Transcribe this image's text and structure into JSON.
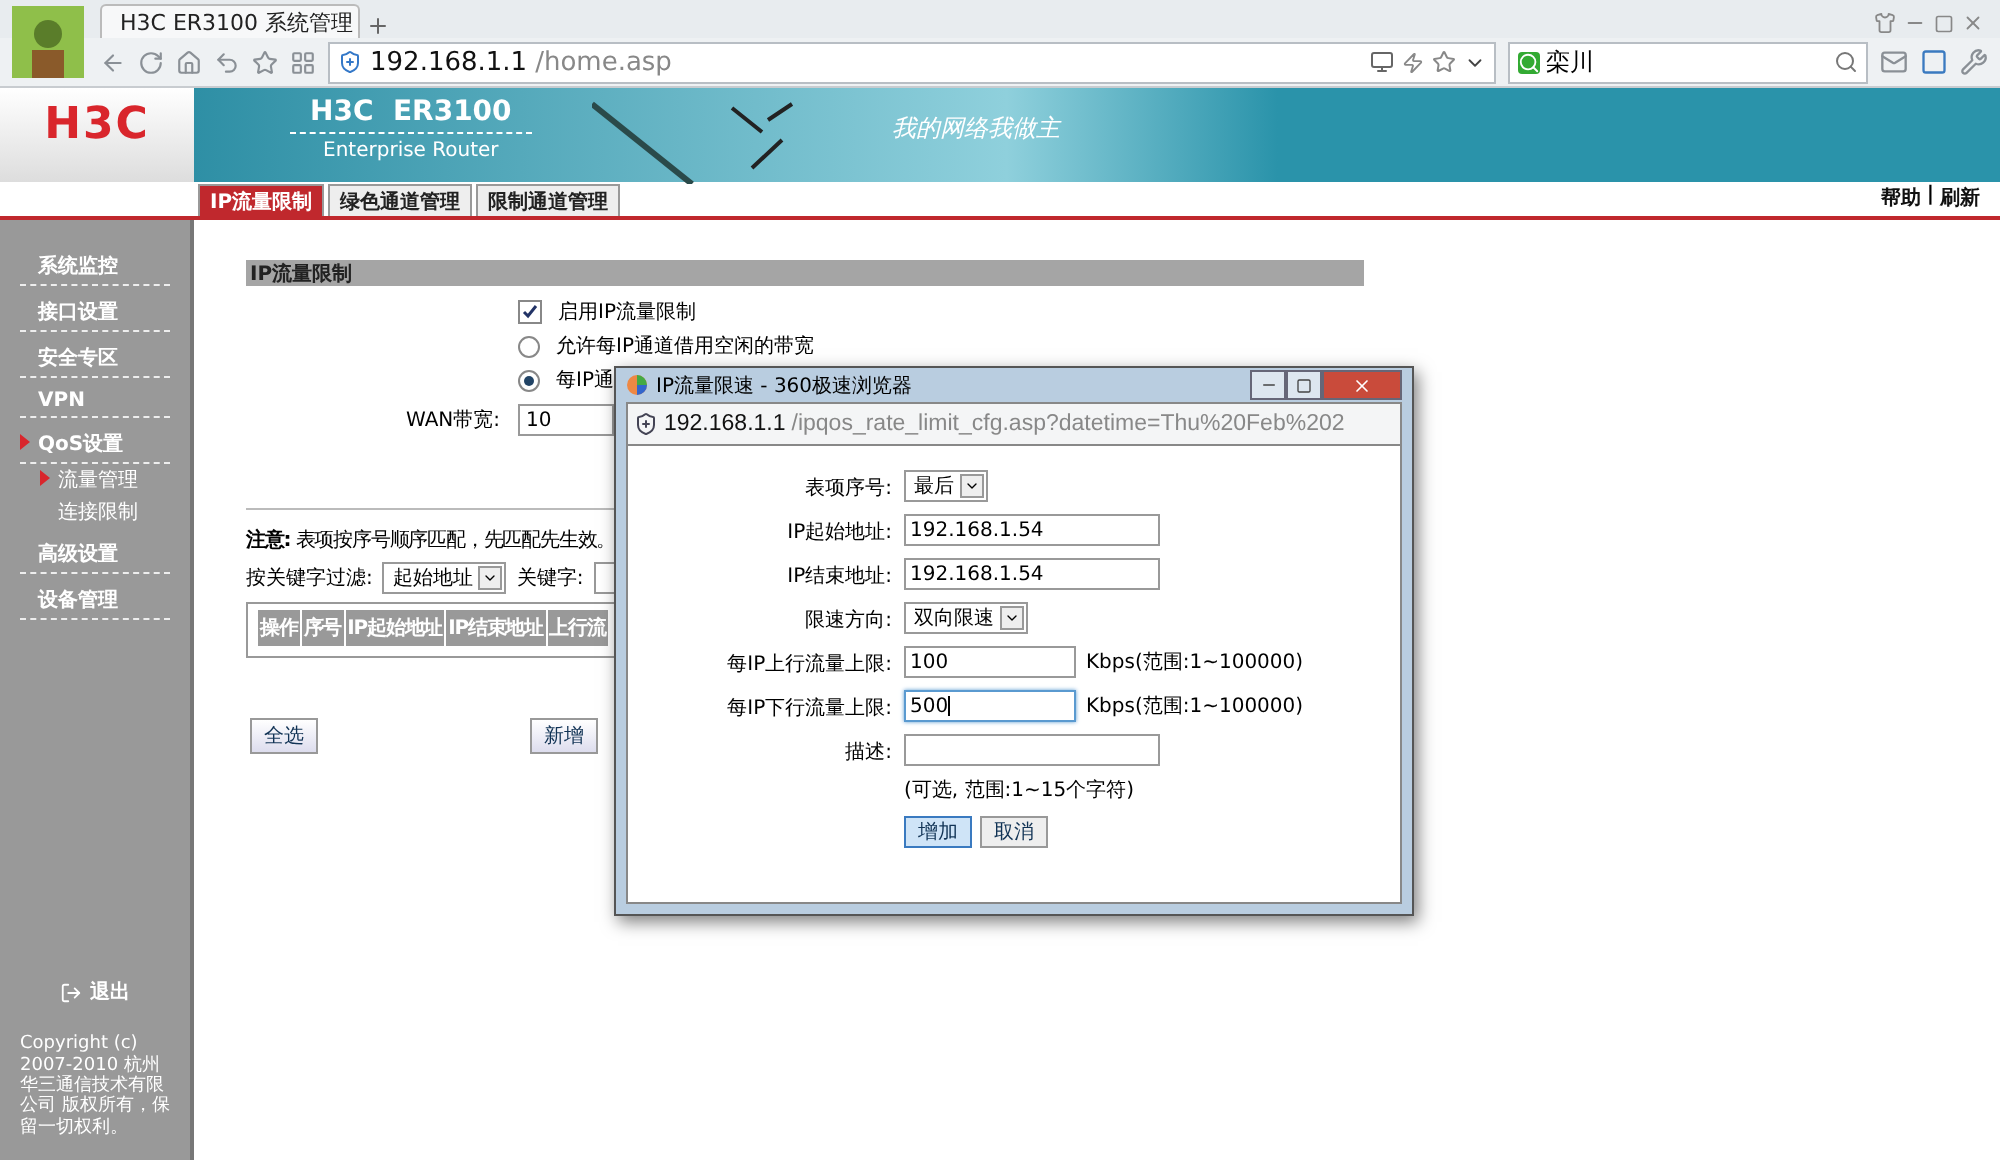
{
  "browser": {
    "tab_title": "H3C ER3100 系统管理",
    "address_host": "192.168.1.1",
    "address_path": "/home.asp",
    "search_value": "栾川"
  },
  "router": {
    "logo": "H3C",
    "banner_title": "H3C  ER3100",
    "banner_subtitle": "Enterprise Router",
    "banner_slogan": "我的网络我做主",
    "tabs": [
      {
        "label": "IP流量限制",
        "selected": true
      },
      {
        "label": "绿色通道管理",
        "selected": false
      },
      {
        "label": "限制通道管理",
        "selected": false
      }
    ],
    "header_links": [
      "帮助",
      "刷新"
    ],
    "header_separator": "|"
  },
  "sidebar": {
    "items": [
      {
        "label": "系统监控",
        "selected": false
      },
      {
        "label": "接口设置",
        "selected": false
      },
      {
        "label": "安全专区",
        "selected": false
      },
      {
        "label": "VPN",
        "selected": false
      },
      {
        "label": "QoS设置",
        "selected": true,
        "children": [
          {
            "label": "流量管理",
            "selected": true
          },
          {
            "label": "连接限制",
            "selected": false
          }
        ]
      },
      {
        "label": "高级设置",
        "selected": false
      },
      {
        "label": "设备管理",
        "selected": false
      }
    ],
    "logout": "退出",
    "copyright": "Copyright (c) 2007-2010 杭州华三通信技术有限公司 版权所有，保留一切权利。"
  },
  "panel": {
    "title": "IP流量限制",
    "options": [
      {
        "kind": "checkbox",
        "label": "启用IP流量限制",
        "checked": true
      },
      {
        "kind": "radio",
        "label": "允许每IP通道借用空闲的带宽",
        "selected": false
      },
      {
        "kind": "radio",
        "label": "每IP通",
        "selected": true
      }
    ],
    "wan_label": "WAN带宽:",
    "wan_value": "10",
    "note": "**注意:** 表项按序号顺序匹配，先匹配先生效。",
    "filter_label": "按关键字过滤:",
    "filter_value": "起始地址",
    "keyword_label": "关键字:",
    "table": {
      "columns": [
        "操作",
        "序号",
        "IP起始地址",
        "IP结束地址",
        "上行流"
      ]
    },
    "buttons": [
      "全选",
      "新增"
    ]
  },
  "popup": {
    "title": "IP流量限速 - 360极速浏览器",
    "address_host": "192.168.1.1",
    "address_path": "/ipqos_rate_limit_cfg.asp?datetime=Thu%20Feb%202",
    "fields": [
      {
        "kind": "select",
        "label": "表项序号:",
        "value": "最后"
      },
      {
        "kind": "input",
        "label": "IP起始地址:",
        "value": "192.168.1.54",
        "focused": false
      },
      {
        "kind": "input",
        "label": "IP结束地址:",
        "value": "192.168.1.54",
        "focused": false
      },
      {
        "kind": "select",
        "label": "限速方向:",
        "value": "双向限速"
      },
      {
        "kind": "input",
        "label": "每IP上行流量上限:",
        "value": "100",
        "hint": "Kbps(范围:1~100000)",
        "focused": false
      },
      {
        "kind": "input",
        "label": "每IP下行流量上限:",
        "value": "500",
        "hint": "Kbps(范围:1~100000)",
        "focused": true
      },
      {
        "kind": "input",
        "label": "描述:",
        "hint": "(可选, 范围:1~15个字符)",
        "focused": false
      }
    ],
    "buttons": [
      {
        "label": "增加",
        "primary": true
      },
      {
        "label": "取消",
        "primary": false
      }
    ]
  }
}
